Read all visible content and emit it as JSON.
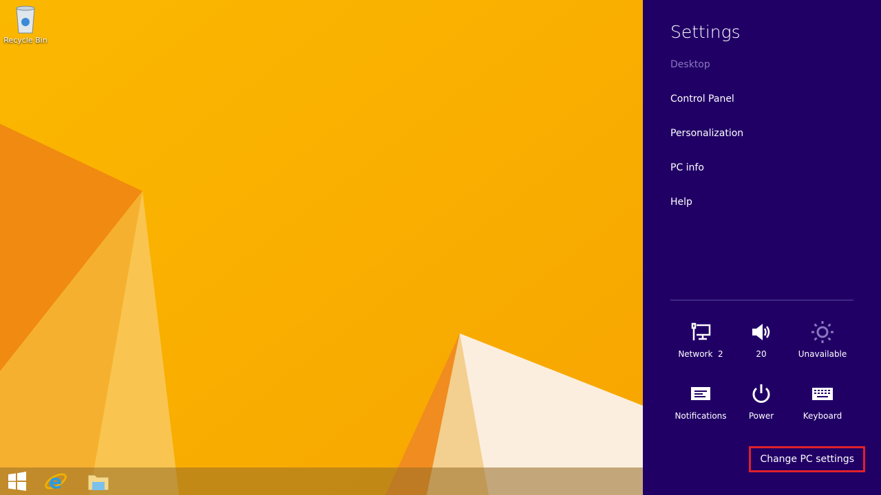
{
  "desktop": {
    "icons": [
      {
        "label": "Recycle Bin",
        "icon": "recycle-bin-icon"
      }
    ]
  },
  "taskbar": {
    "items": [
      {
        "name": "start",
        "icon": "windows-logo-icon"
      },
      {
        "name": "internet-explorer",
        "icon": "ie-icon"
      },
      {
        "name": "file-explorer",
        "icon": "folder-icon"
      }
    ]
  },
  "charm": {
    "title": "Settings",
    "context": "Desktop",
    "items": [
      "Control Panel",
      "Personalization",
      "PC info",
      "Help"
    ],
    "quick": [
      {
        "label": "Network  2",
        "icon": "network-icon"
      },
      {
        "label": "20",
        "icon": "volume-icon"
      },
      {
        "label": "Unavailable",
        "icon": "brightness-icon"
      },
      {
        "label": "Notifications",
        "icon": "notifications-icon"
      },
      {
        "label": "Power",
        "icon": "power-icon"
      },
      {
        "label": "Keyboard",
        "icon": "keyboard-icon"
      }
    ],
    "change": "Change PC settings",
    "bg": "#210066",
    "highlight": "#e0202a"
  }
}
